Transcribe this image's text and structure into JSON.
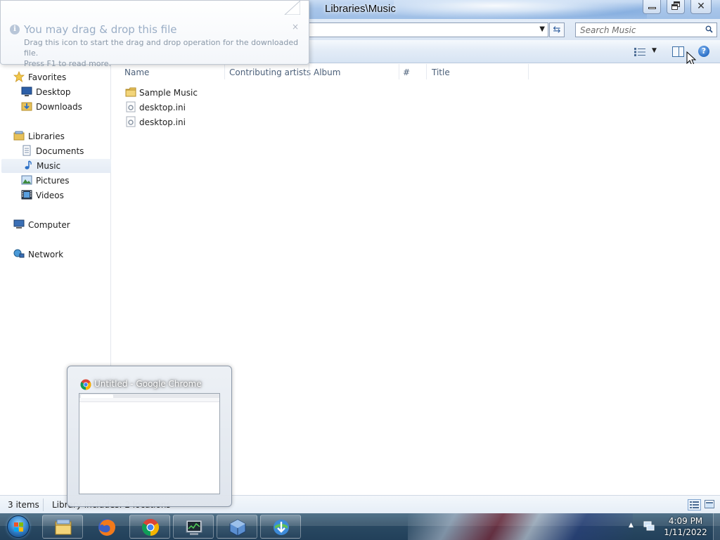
{
  "window": {
    "title": "Libraries\\Music"
  },
  "search": {
    "placeholder": "Search Music"
  },
  "tooltip": {
    "title": "You may drag & drop this file",
    "line1": "Drag this icon to start the drag and drop operation for the downloaded file.",
    "line2": "Press F1 to read more.",
    "close_glyph": "×"
  },
  "nav": {
    "favorites": "Favorites",
    "desktop": "Desktop",
    "downloads": "Downloads",
    "libraries": "Libraries",
    "documents": "Documents",
    "music": "Music",
    "pictures": "Pictures",
    "videos": "Videos",
    "computer": "Computer",
    "network": "Network"
  },
  "columns": {
    "name": "Name",
    "contributing_artists": "Contributing artists",
    "album": "Album",
    "number": "#",
    "title": "Title"
  },
  "files": [
    {
      "name": "Sample Music",
      "icon": "folder-icon"
    },
    {
      "name": "desktop.ini",
      "icon": "settings-file-icon"
    },
    {
      "name": "desktop.ini",
      "icon": "settings-file-icon"
    }
  ],
  "status": {
    "item_count": "3 items",
    "library_text": "Library includes: 2 locations"
  },
  "thumbnail": {
    "title": "Untitled - Google Chrome"
  },
  "taskbar": {
    "apps": [
      "windows-explorer",
      "firefox",
      "google-chrome",
      "task-manager",
      "virtualbox",
      "internet-download-manager"
    ],
    "time": "4:09 PM",
    "date": "1/11/2022"
  },
  "colors": {
    "accent": "#2b6fc6",
    "taskbar": "#2a4a63"
  }
}
